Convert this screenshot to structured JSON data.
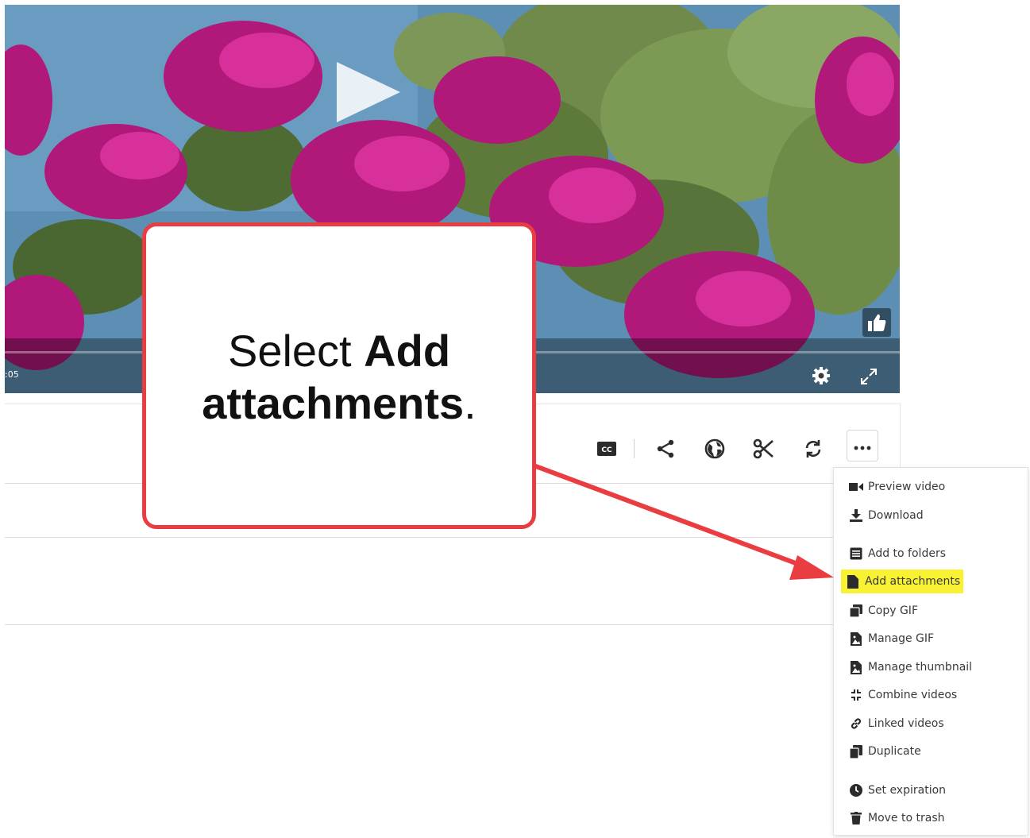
{
  "player": {
    "timecode": ":05",
    "icons": [
      "play-icon",
      "thumbs-up-icon",
      "settings-gear-icon",
      "fullscreen-icon"
    ]
  },
  "toolbar": {
    "icons": [
      "closed-captions-icon",
      "share-icon",
      "globe-icon",
      "scissors-icon",
      "replace-icon",
      "more-options-icon"
    ],
    "cc_label": "CC"
  },
  "menu": {
    "items": [
      {
        "label": "Preview video",
        "icon": "video-camera-icon"
      },
      {
        "label": "Download",
        "icon": "download-icon"
      },
      {
        "label": "Add to folders",
        "icon": "folder-list-icon"
      },
      {
        "label": "Add attachments",
        "icon": "file-icon",
        "highlighted": true
      },
      {
        "label": "Copy GIF",
        "icon": "copy-icon"
      },
      {
        "label": "Manage GIF",
        "icon": "image-file-icon"
      },
      {
        "label": "Manage thumbnail",
        "icon": "image-file-icon"
      },
      {
        "label": "Combine videos",
        "icon": "combine-icon"
      },
      {
        "label": "Linked videos",
        "icon": "link-icon"
      },
      {
        "label": "Duplicate",
        "icon": "duplicate-icon"
      },
      {
        "label": "Set expiration",
        "icon": "clock-icon"
      },
      {
        "label": "Move to trash",
        "icon": "trash-icon"
      }
    ],
    "highlight_color": "#f8f233"
  },
  "callout": {
    "prefix": "Select ",
    "bold1": "Add",
    "bold2": "attachments",
    "suffix": ".",
    "border_color": "#ea3d42"
  }
}
